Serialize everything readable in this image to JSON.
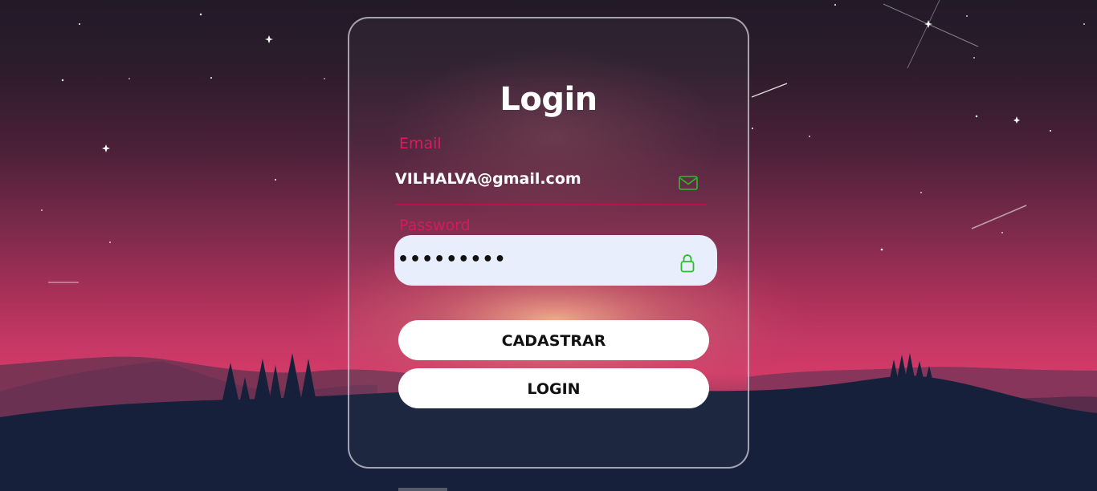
{
  "form": {
    "title": "Login",
    "email_label": "Email",
    "email_value": "VILHALVA@gmail.com",
    "password_label": "Password",
    "password_value": "•••••••••",
    "signup_button": "CADASTRAR",
    "login_button": "LOGIN"
  },
  "icons": {
    "email": "envelope-icon",
    "password": "lock-icon"
  },
  "colors": {
    "label": "#e3175e",
    "underline": "#b5134c",
    "icon": "#2bbd2b",
    "password_bg": "#e8eefb",
    "button_bg": "#ffffff"
  }
}
